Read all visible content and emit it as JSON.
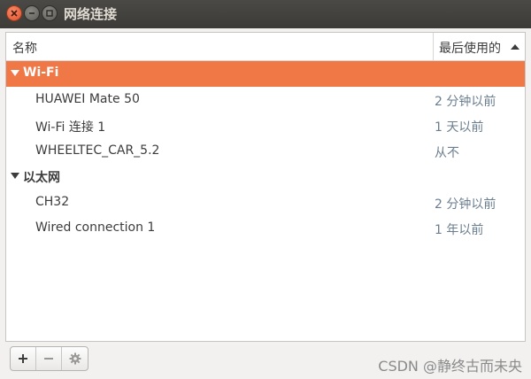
{
  "window": {
    "title": "网络连接"
  },
  "header": {
    "name_col": "名称",
    "last_used_col": "最后使用的"
  },
  "groups": [
    {
      "name": "Wi-Fi",
      "items": [
        {
          "name": "HUAWEI Mate 50",
          "last_used": "2 分钟以前"
        },
        {
          "name": "Wi-Fi 连接 1",
          "last_used": "1 天以前"
        },
        {
          "name": "WHEELTEC_CAR_5.2",
          "last_used": "从不"
        }
      ]
    },
    {
      "name": "以太网",
      "items": [
        {
          "name": "CH32",
          "last_used": "2 分钟以前"
        },
        {
          "name": "Wired connection 1",
          "last_used": "1 年以前"
        }
      ]
    }
  ],
  "toolbar": {
    "add_icon": "plus-icon",
    "remove_icon": "minus-icon",
    "settings_icon": "gear-icon"
  },
  "watermark": "CSDN @静终古而未央",
  "colors": {
    "selection": "#f07746",
    "titlebar": "#3c3b37",
    "time_text": "#6b7e8f"
  }
}
